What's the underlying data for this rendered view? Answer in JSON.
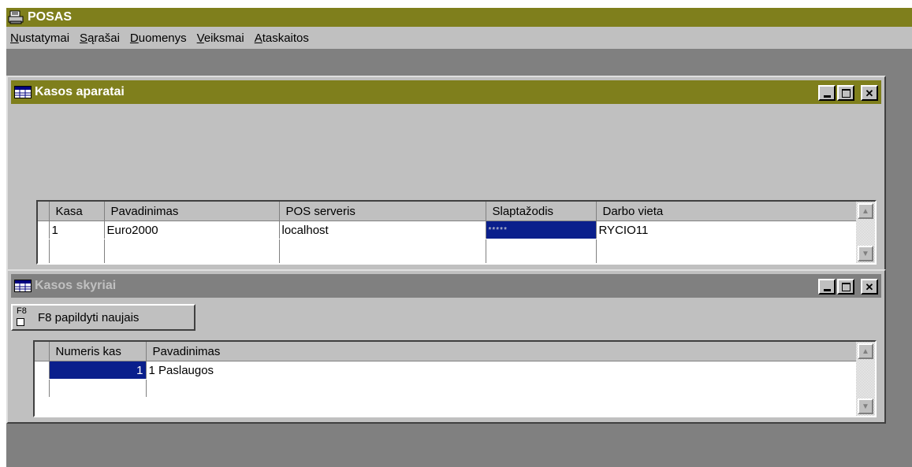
{
  "app": {
    "title": "POSAS"
  },
  "menu": [
    {
      "label": "Nustatymai",
      "ul": "N",
      "rest": "ustatymai"
    },
    {
      "label": "Sąrašai",
      "ul": "S",
      "rest": "ąrašai"
    },
    {
      "label": "Duomenys",
      "ul": "D",
      "rest": "uomenys"
    },
    {
      "label": "Veiksmai",
      "ul": "V",
      "rest": "eiksmai"
    },
    {
      "label": "Ataskaitos",
      "ul": "A",
      "rest": "taskaitos"
    }
  ],
  "window1": {
    "title": "Kasos aparatai",
    "columns": [
      "Kasa",
      "Pavadinimas",
      "POS serveris",
      "Slaptažodis",
      "Darbo vieta"
    ],
    "rows": [
      {
        "kasa": "1",
        "pavadinimas": "Euro2000",
        "server": "localhost",
        "password": "*****",
        "darbo_vieta": "RYCIO11"
      }
    ]
  },
  "window2": {
    "title": "Kasos skyriai",
    "button": {
      "icon": "F8",
      "label": "F8 papildyti naujais"
    },
    "columns": [
      "Numeris kas",
      "Pavadinimas"
    ],
    "rows": [
      {
        "numeris": "1",
        "pavadinimas": "1 Paslaugos"
      }
    ]
  },
  "icons": {
    "app": "printer-icon",
    "grid": "table-grid-icon",
    "minimize": "minimize-icon",
    "maximize": "maximize-icon",
    "close": "close-icon",
    "scroll_up": "arrow-up-icon",
    "scroll_down": "arrow-down-icon"
  },
  "colors": {
    "title_active": "#7f7f1c",
    "title_inactive": "#808080",
    "selection": "#0a1f8c",
    "face": "#c0c0c0"
  }
}
